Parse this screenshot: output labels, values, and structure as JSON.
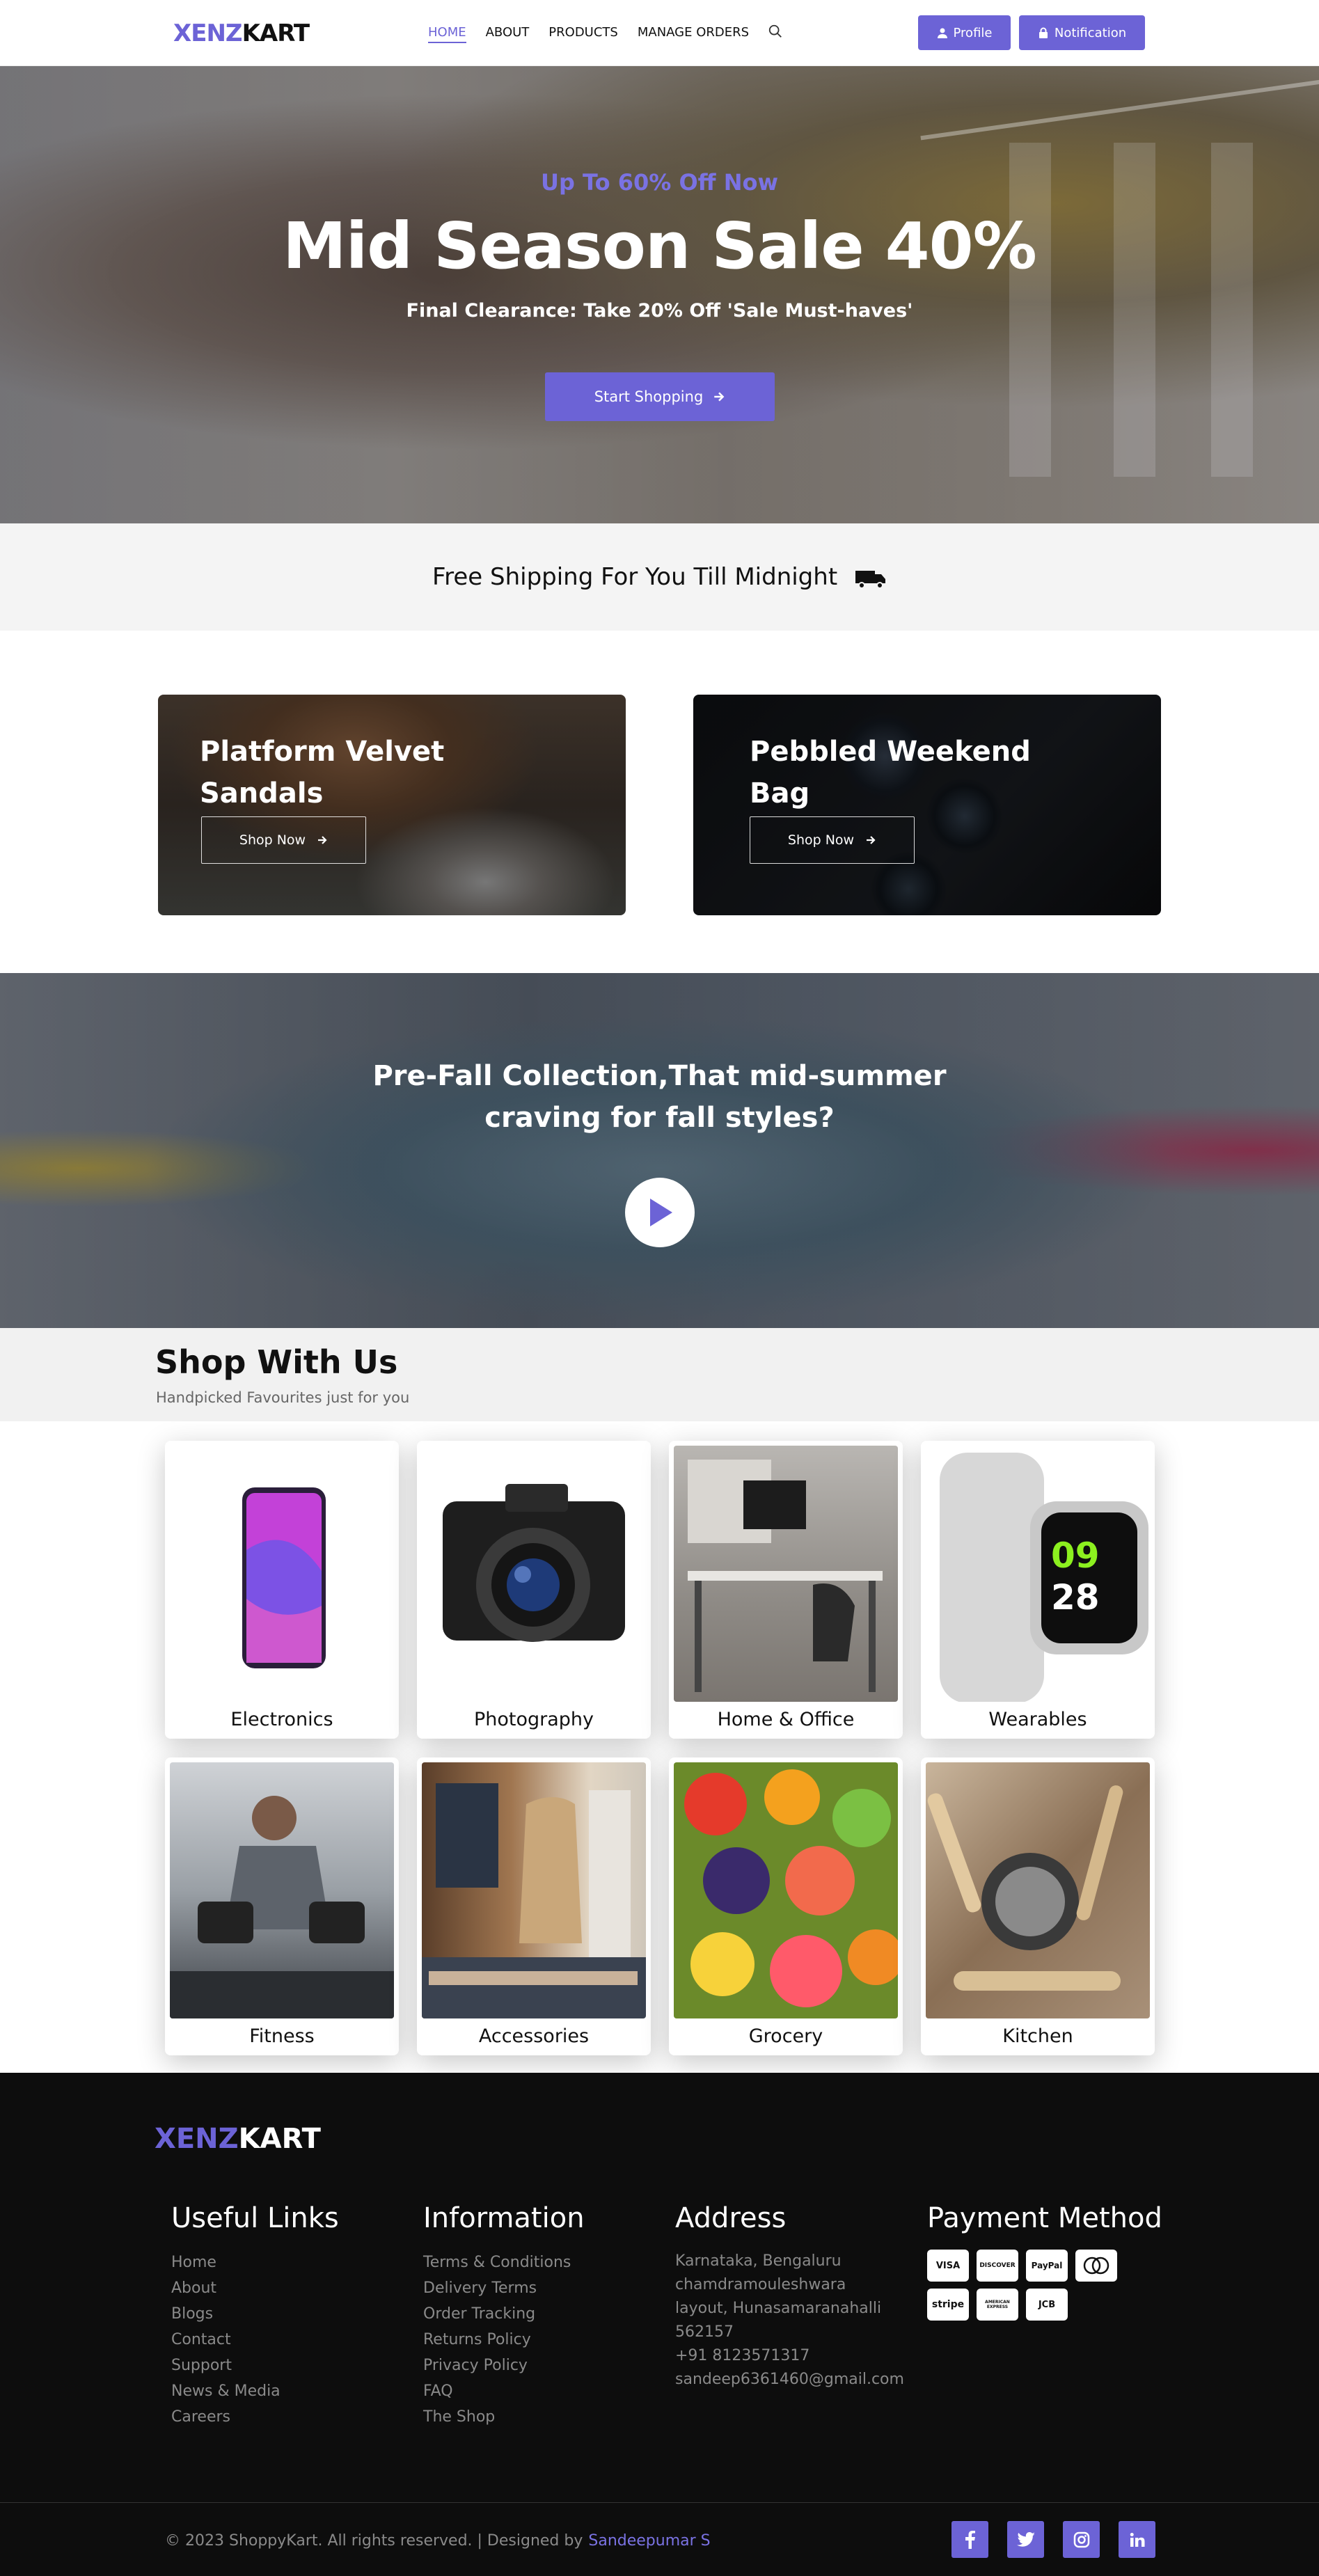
{
  "brand": {
    "name_part1": "XENZ",
    "name_part2": "KART",
    "accent_color": "#6c63d6"
  },
  "nav": {
    "links": [
      "HOME",
      "ABOUT",
      "PRODUCTS",
      "MANAGE ORDERS"
    ],
    "active": "HOME",
    "search_icon": "search-icon",
    "profile_label": "Profile",
    "notification_label": "Notification"
  },
  "hero": {
    "subtitle": "Up To 60% Off Now",
    "title": "Mid Season Sale 40%",
    "tagline": "Final Clearance: Take 20% Off 'Sale Must-haves'",
    "cta": "Start Shopping"
  },
  "shipping": {
    "text": "Free Shipping For You Till Midnight",
    "icon": "truck-icon"
  },
  "promos": [
    {
      "title": "Platform Velvet Sandals",
      "cta": "Shop Now"
    },
    {
      "title": "Pebbled Weekend Bag",
      "cta": "Shop Now"
    }
  ],
  "video_banner": {
    "title_line1": "Pre-Fall Collection,That mid-summer",
    "title_line2": "craving for fall styles?",
    "icon": "play-icon"
  },
  "shop": {
    "title": "Shop With Us",
    "subtitle": "Handpicked Favourites just for you",
    "categories": [
      "Electronics",
      "Photography",
      "Home & Office",
      "Wearables",
      "Fitness",
      "Accessories",
      "Grocery",
      "Kitchen"
    ]
  },
  "footer": {
    "useful_links_title": "Useful Links",
    "useful_links": [
      "Home",
      "About",
      "Blogs",
      "Contact",
      "Support",
      "News & Media",
      "Careers"
    ],
    "information_title": "Information",
    "information": [
      "Terms & Conditions",
      "Delivery Terms",
      "Order Tracking",
      "Returns Policy",
      "Privacy Policy",
      "FAQ",
      "The Shop"
    ],
    "address_title": "Address",
    "address_lines": [
      "Karnataka, Bengaluru chamdramouleshwara layout, Hunasamaranahalli 562157",
      "+91 8123571317",
      "sandeep6361460@gmail.com"
    ],
    "payment_title": "Payment Method",
    "payment_methods": [
      "VISA",
      "DISCOVER",
      "PayPal",
      "MasterCard",
      "stripe",
      "AMERICAN EXPRESS",
      "JCB"
    ],
    "copyright": "© 2023 ShoppyKart. All rights reserved. | Designed by",
    "designer": "Sandeepumar S",
    "socials": [
      "facebook-icon",
      "twitter-icon",
      "instagram-icon",
      "linkedin-icon"
    ]
  }
}
